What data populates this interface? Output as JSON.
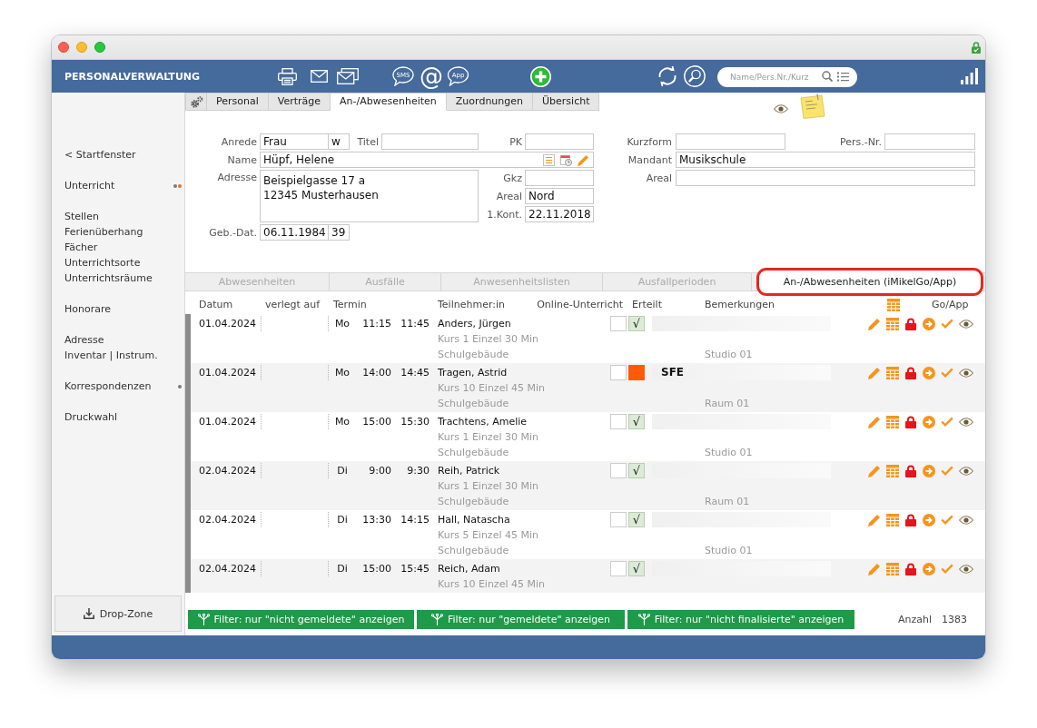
{
  "header": {
    "title": "PERSONALVERWALTUNG",
    "sms_label": "SMS",
    "at_label": "@",
    "app_label": "App",
    "search": {
      "placeholder": "Name/Pers.Nr./Kurz"
    }
  },
  "sidebar": {
    "groups": [
      {
        "items": [
          {
            "label": "< Startfenster"
          }
        ]
      },
      {
        "items": [
          {
            "label": "Unterricht",
            "dots": [
              {
                "color": "#7a7a7a"
              },
              {
                "color": "#f26a2a"
              }
            ]
          }
        ]
      },
      {
        "items": [
          {
            "label": "Stellen"
          },
          {
            "label": "Ferienüberhang"
          },
          {
            "label": "Fächer"
          },
          {
            "label": "Unterrichtsorte"
          },
          {
            "label": "Unterrichtsräume"
          }
        ]
      },
      {
        "items": [
          {
            "label": "Honorare"
          }
        ]
      },
      {
        "items": [
          {
            "label": "Adresse"
          },
          {
            "label": "Inventar | Instrum."
          }
        ]
      },
      {
        "items": [
          {
            "label": "Korrespondenzen",
            "dots": [
              {
                "color": "#7a7a7a"
              }
            ]
          }
        ]
      },
      {
        "items": [
          {
            "label": "Druckwahl"
          }
        ]
      }
    ],
    "drop_zone": {
      "label": "Drop-Zone"
    }
  },
  "tabs": [
    {
      "label": "Personal",
      "selected": false
    },
    {
      "label": "Verträge",
      "selected": false
    },
    {
      "label": "An-/Abwesenheiten",
      "selected": true
    },
    {
      "label": "Zuordnungen",
      "selected": false
    },
    {
      "label": "Übersicht",
      "selected": false
    }
  ],
  "form": {
    "anrede": {
      "label": "Anrede",
      "value": "Frau"
    },
    "gender": {
      "value": "w"
    },
    "titel": {
      "label": "Titel"
    },
    "pk": {
      "label": "PK"
    },
    "kurzform": {
      "label": "Kurzform"
    },
    "pers_nr": {
      "label": "Pers.-Nr."
    },
    "name": {
      "label": "Name",
      "value": "Hüpf, Helene"
    },
    "mandant": {
      "label": "Mandant",
      "value": "Musikschule"
    },
    "adresse": {
      "label": "Adresse",
      "lines": [
        "Beispielgasse 17 a",
        "12345 Musterhausen"
      ]
    },
    "gkz": {
      "label": "Gkz"
    },
    "areal": {
      "label": "Areal",
      "value": "Nord"
    },
    "areal_2": {
      "label": "Areal"
    },
    "first_contact": {
      "label": "1.Kont.",
      "value": "22.11.2018"
    },
    "birth_date": {
      "label": "Geb.-Dat.",
      "value": "06.11.1984"
    },
    "age": {
      "value": "39"
    }
  },
  "subtabs": [
    {
      "label": "Abwesenheiten",
      "disabled": true,
      "highlighted": false
    },
    {
      "label": "Ausfälle",
      "disabled": true,
      "highlighted": false
    },
    {
      "label": "Anwesenheitslisten",
      "disabled": true,
      "highlighted": false
    },
    {
      "label": "Ausfallperioden",
      "disabled": true,
      "highlighted": false
    },
    {
      "label": "An-/Abwesenheiten (iMikelGo/App)",
      "disabled": false,
      "highlighted": true
    }
  ],
  "table": {
    "columns": [
      {
        "kind": "text",
        "label": "Datum"
      },
      {
        "kind": "text",
        "label": "verlegt auf"
      },
      {
        "kind": "text",
        "label": "Termin"
      },
      {
        "kind": "text",
        "label": "Teilnehmer:in"
      },
      {
        "kind": "text",
        "label": "Online-Unterricht"
      },
      {
        "kind": "text",
        "label": "Erteilt"
      },
      {
        "kind": "text",
        "label": "Bemerkungen"
      },
      {
        "kind": "icon"
      },
      {
        "kind": "text",
        "label": "Go/App"
      }
    ],
    "rows": [
      {
        "kind": "given",
        "date": "01.04.2024",
        "day": "Mo",
        "start": "11:15",
        "end": "11:45",
        "participant": "Anders, Jürgen",
        "course": "Kurs 1 Einzel 30 Min",
        "location": "Schulgebäude",
        "room": "Studio 01",
        "online": false,
        "erteilt_mark": "√"
      },
      {
        "kind": "absent",
        "date": "01.04.2024",
        "day": "Mo",
        "start": "14:00",
        "end": "14:45",
        "participant": "Tragen, Astrid",
        "course": "Kurs 10 Einzel 45 Min",
        "location": "Schulgebäude",
        "room": "Raum 01",
        "online": false,
        "remark": "SFE"
      },
      {
        "kind": "given",
        "date": "01.04.2024",
        "day": "Mo",
        "start": "15:00",
        "end": "15:30",
        "participant": "Trachtens, Amelie",
        "course": "Kurs 1 Einzel 30 Min",
        "location": "Schulgebäude",
        "room": "Studio 01",
        "online": false,
        "erteilt_mark": "√"
      },
      {
        "kind": "given",
        "date": "02.04.2024",
        "day": "Di",
        "start": "9:00",
        "end": "9:30",
        "participant": "Reih, Patrick",
        "course": "Kurs 1 Einzel 30 Min",
        "location": "Schulgebäude",
        "room": "Raum 01",
        "online": false,
        "erteilt_mark": "√"
      },
      {
        "kind": "given",
        "date": "02.04.2024",
        "day": "Di",
        "start": "13:30",
        "end": "14:15",
        "participant": "Hall, Natascha",
        "course": "Kurs 5 Einzel 45 Min",
        "location": "Schulgebäude",
        "room": "Studio 01",
        "online": false,
        "erteilt_mark": "√"
      },
      {
        "kind": "given",
        "date": "02.04.2024",
        "day": "Di",
        "start": "15:00",
        "end": "15:45",
        "participant": "Reich, Adam",
        "course": "Kurs 10 Einzel 45 Min",
        "online": false,
        "erteilt_mark": "√"
      }
    ]
  },
  "filters": [
    {
      "label": "Filter: nur \"nicht gemeldete\" anzeigen"
    },
    {
      "label": "Filter: nur \"gemeldete\" anzeigen"
    },
    {
      "label": "Filter: nur \"nicht finalisierte\" anzeigen"
    }
  ],
  "count": {
    "label": "Anzahl",
    "value": "1383"
  }
}
